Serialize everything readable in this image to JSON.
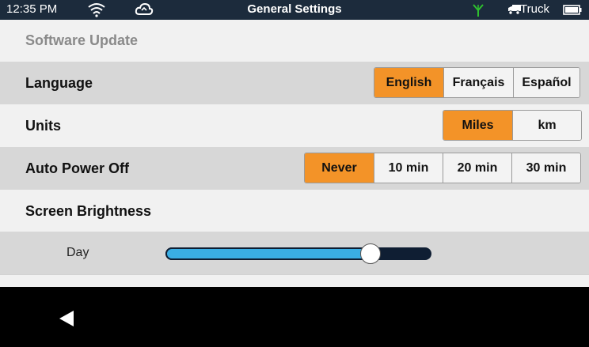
{
  "status_bar": {
    "time": "12:35 PM",
    "title": "General Settings",
    "vehicle": "Truck",
    "icons": [
      "wifi-icon",
      "cloud-sync-icon",
      "gps-signal-icon",
      "truck-icon",
      "battery-icon"
    ]
  },
  "settings": {
    "software_update": "Software Update",
    "language": {
      "label": "Language",
      "options": [
        "English",
        "Français",
        "Español"
      ],
      "selected": "English"
    },
    "units": {
      "label": "Units",
      "options": [
        "Miles",
        "km"
      ],
      "selected": "Miles"
    },
    "auto_power_off": {
      "label": "Auto Power Off",
      "options": [
        "Never",
        "10 min",
        "20 min",
        "30 min"
      ],
      "selected": "Never"
    },
    "screen_brightness": {
      "label": "Screen Brightness",
      "day_label": "Day",
      "day_level": 0.77
    }
  },
  "nav": {
    "back_icon": "back-arrow-icon"
  },
  "colors": {
    "status_bar": "#1c2b3c",
    "accent": "#f39328",
    "slider_fill": "#3aaee4",
    "slider_track": "#0f1e33",
    "row_gray": "#d7d7d7",
    "row_light": "#f1f1f1"
  }
}
